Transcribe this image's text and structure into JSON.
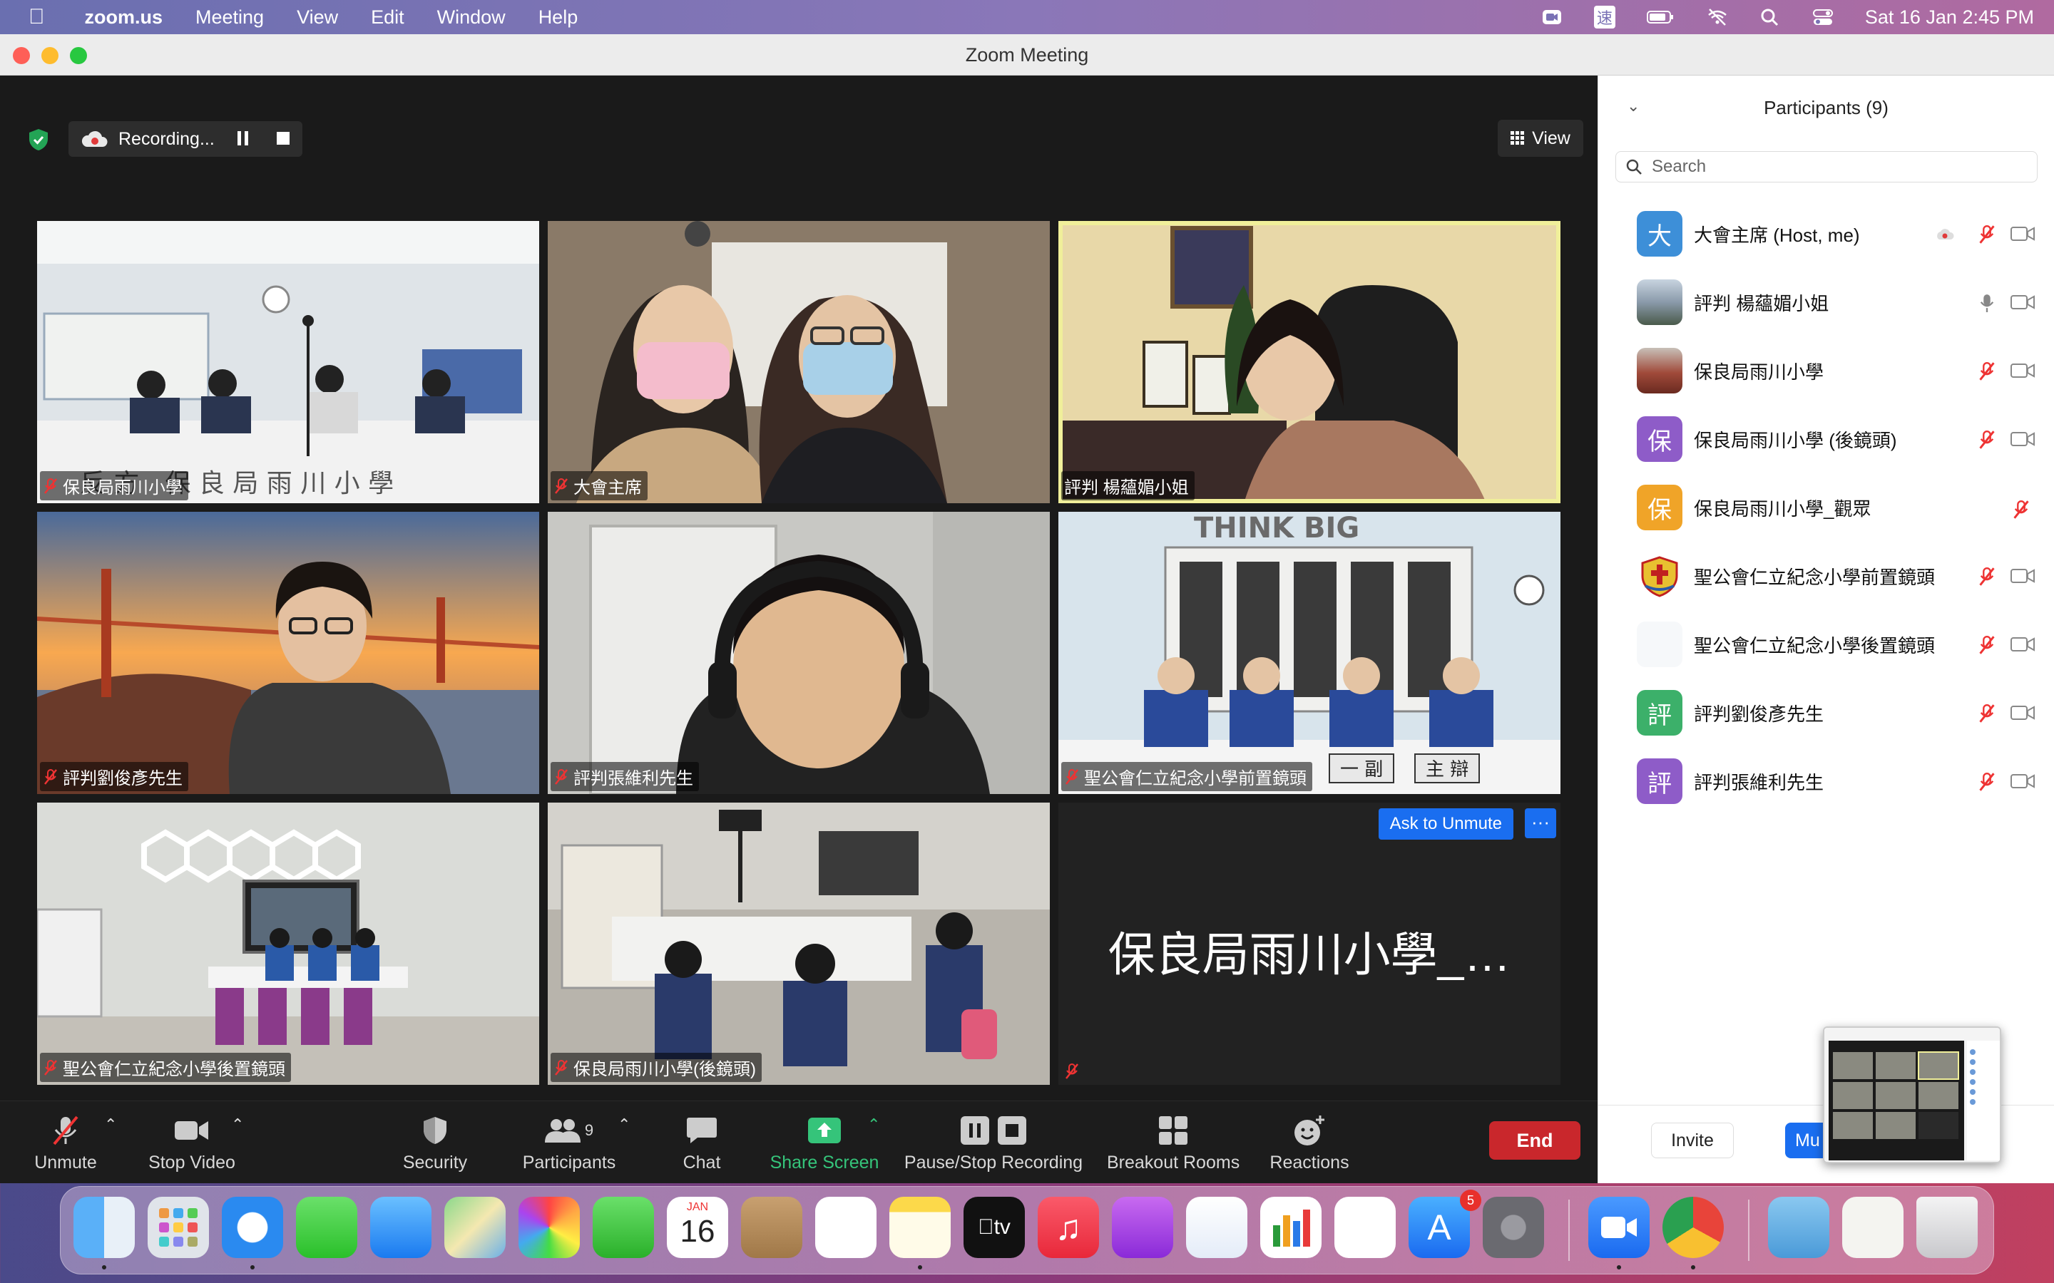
{
  "menubar": {
    "app_name": "zoom.us",
    "items": [
      "Meeting",
      "View",
      "Edit",
      "Window",
      "Help"
    ],
    "input_method": "速",
    "datetime": "Sat 16 Jan  2:45 PM"
  },
  "window": {
    "title": "Zoom Meeting"
  },
  "recording": {
    "label": "Recording..."
  },
  "view_button": "View",
  "tiles": [
    {
      "name": "保良局雨川小學",
      "muted": true,
      "active": false,
      "scene": "classroom-white"
    },
    {
      "name": "大會主席",
      "muted": true,
      "active": false,
      "scene": "two-people"
    },
    {
      "name": "評判 楊蘊媚小姐",
      "muted": false,
      "active": true,
      "scene": "office-yellow"
    },
    {
      "name": "評判劉俊彥先生",
      "muted": true,
      "active": false,
      "scene": "golden-gate"
    },
    {
      "name": "評判張維利先生",
      "muted": true,
      "active": false,
      "scene": "headphones"
    },
    {
      "name": "聖公會仁立紀念小學前置鏡頭",
      "muted": true,
      "active": false,
      "scene": "four-students"
    },
    {
      "name": "聖公會仁立紀念小學後置鏡頭",
      "muted": true,
      "active": false,
      "scene": "classroom-purple"
    },
    {
      "name": "保良局雨川小學(後鏡頭)",
      "muted": true,
      "active": false,
      "scene": "classroom-back"
    },
    {
      "name": "",
      "muted": true,
      "active": false,
      "scene": "no-video",
      "big_name": "保良局雨川小學_…",
      "ask_unmute": "Ask to Unmute",
      "more": "···"
    }
  ],
  "toolbar": {
    "unmute": "Unmute",
    "stop_video": "Stop Video",
    "security": "Security",
    "participants": "Participants",
    "participants_count": "9",
    "chat": "Chat",
    "share_screen": "Share Screen",
    "pause_stop_recording": "Pause/Stop Recording",
    "breakout_rooms": "Breakout Rooms",
    "reactions": "Reactions",
    "end": "End"
  },
  "panel": {
    "title": "Participants (9)",
    "search_placeholder": "Search",
    "participants": [
      {
        "name": "大會主席 (Host, me)",
        "avatar": "大",
        "avatar_color": "#3d8fd8",
        "mic": "muted",
        "video": "off",
        "recording": true
      },
      {
        "name": "評判 楊蘊媚小姐",
        "avatar": "",
        "avatar_color": "#7a8a9a",
        "mic": "on",
        "video": "off",
        "recording": false
      },
      {
        "name": "保良局雨川小學",
        "avatar": "",
        "avatar_color": "#a04a3a",
        "mic": "muted",
        "video": "off",
        "recording": false
      },
      {
        "name": "保良局雨川小學 (後鏡頭)",
        "avatar": "保",
        "avatar_color": "#8e5cc8",
        "mic": "muted",
        "video": "off",
        "recording": false
      },
      {
        "name": "保良局雨川小學_觀眾",
        "avatar": "保",
        "avatar_color": "#f0a428",
        "mic": "muted",
        "video": "none",
        "recording": false
      },
      {
        "name": "聖公會仁立紀念小學前置鏡頭",
        "avatar": "",
        "avatar_color": "#e8c030",
        "mic": "muted",
        "video": "off",
        "recording": false
      },
      {
        "name": "聖公會仁立紀念小學後置鏡頭",
        "avatar": "",
        "avatar_color": "#f4f4f4",
        "mic": "muted",
        "video": "off",
        "recording": false
      },
      {
        "name": "評判劉俊彥先生",
        "avatar": "評",
        "avatar_color": "#3cb06a",
        "mic": "muted",
        "video": "off",
        "recording": false
      },
      {
        "name": "評判張維利先生",
        "avatar": "評",
        "avatar_color": "#8e5cc8",
        "mic": "muted",
        "video": "off",
        "recording": false
      }
    ],
    "invite": "Invite",
    "mute_all": "Mu"
  },
  "dock": {
    "calendar_month": "JAN",
    "calendar_day": "16",
    "appstore_badge": "5"
  }
}
